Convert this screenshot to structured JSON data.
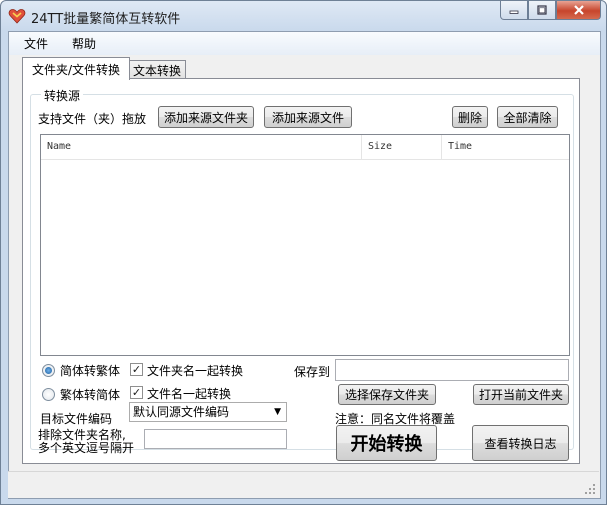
{
  "window": {
    "title": "24TT批量繁简体互转软件"
  },
  "menu": {
    "file": "文件",
    "help": "帮助"
  },
  "tabs": [
    {
      "label": "文件夹/文件转换",
      "active": true
    },
    {
      "label": "文本转换",
      "active": false
    }
  ],
  "source_group": {
    "legend": "转换源",
    "hint": "支持文件（夹）拖放",
    "add_folder_button": "添加来源文件夹",
    "add_file_button": "添加来源文件",
    "delete_button": "删除",
    "clear_all_button": "全部清除"
  },
  "file_list": {
    "columns": [
      "Name",
      "Size",
      "Time"
    ],
    "rows": []
  },
  "options": {
    "radio_s2t": {
      "label": "简体转繁体",
      "checked": true
    },
    "radio_t2s": {
      "label": "繁体转简体",
      "checked": false
    },
    "check_folder_name": {
      "label": "文件夹名一起转换",
      "checked": true
    },
    "check_file_name": {
      "label": "文件名一起转换",
      "checked": true
    },
    "target_encoding_label": "目标文件编码",
    "encoding_selected": "默认同源文件编码",
    "exclude_label_line1": "排除文件夹名称,",
    "exclude_label_line2": "多个英文逗号隔开",
    "exclude_value": ""
  },
  "save": {
    "label": "保存到",
    "path_value": "",
    "choose_folder_button": "选择保存文件夹",
    "open_folder_button": "打开当前文件夹",
    "note": "注意：同名文件将覆盖"
  },
  "actions": {
    "start_button": "开始转换",
    "log_button": "查看转换日志"
  },
  "colors": {
    "title_bar": "#c9d9ec",
    "close_button": "#c7452c",
    "client_bg": "#f0f0f0"
  },
  "icons": {
    "app": "heart-icon",
    "minimize": "minimize-icon",
    "maximize": "maximize-icon",
    "close": "close-icon",
    "grip": "resize-grip-icon"
  }
}
